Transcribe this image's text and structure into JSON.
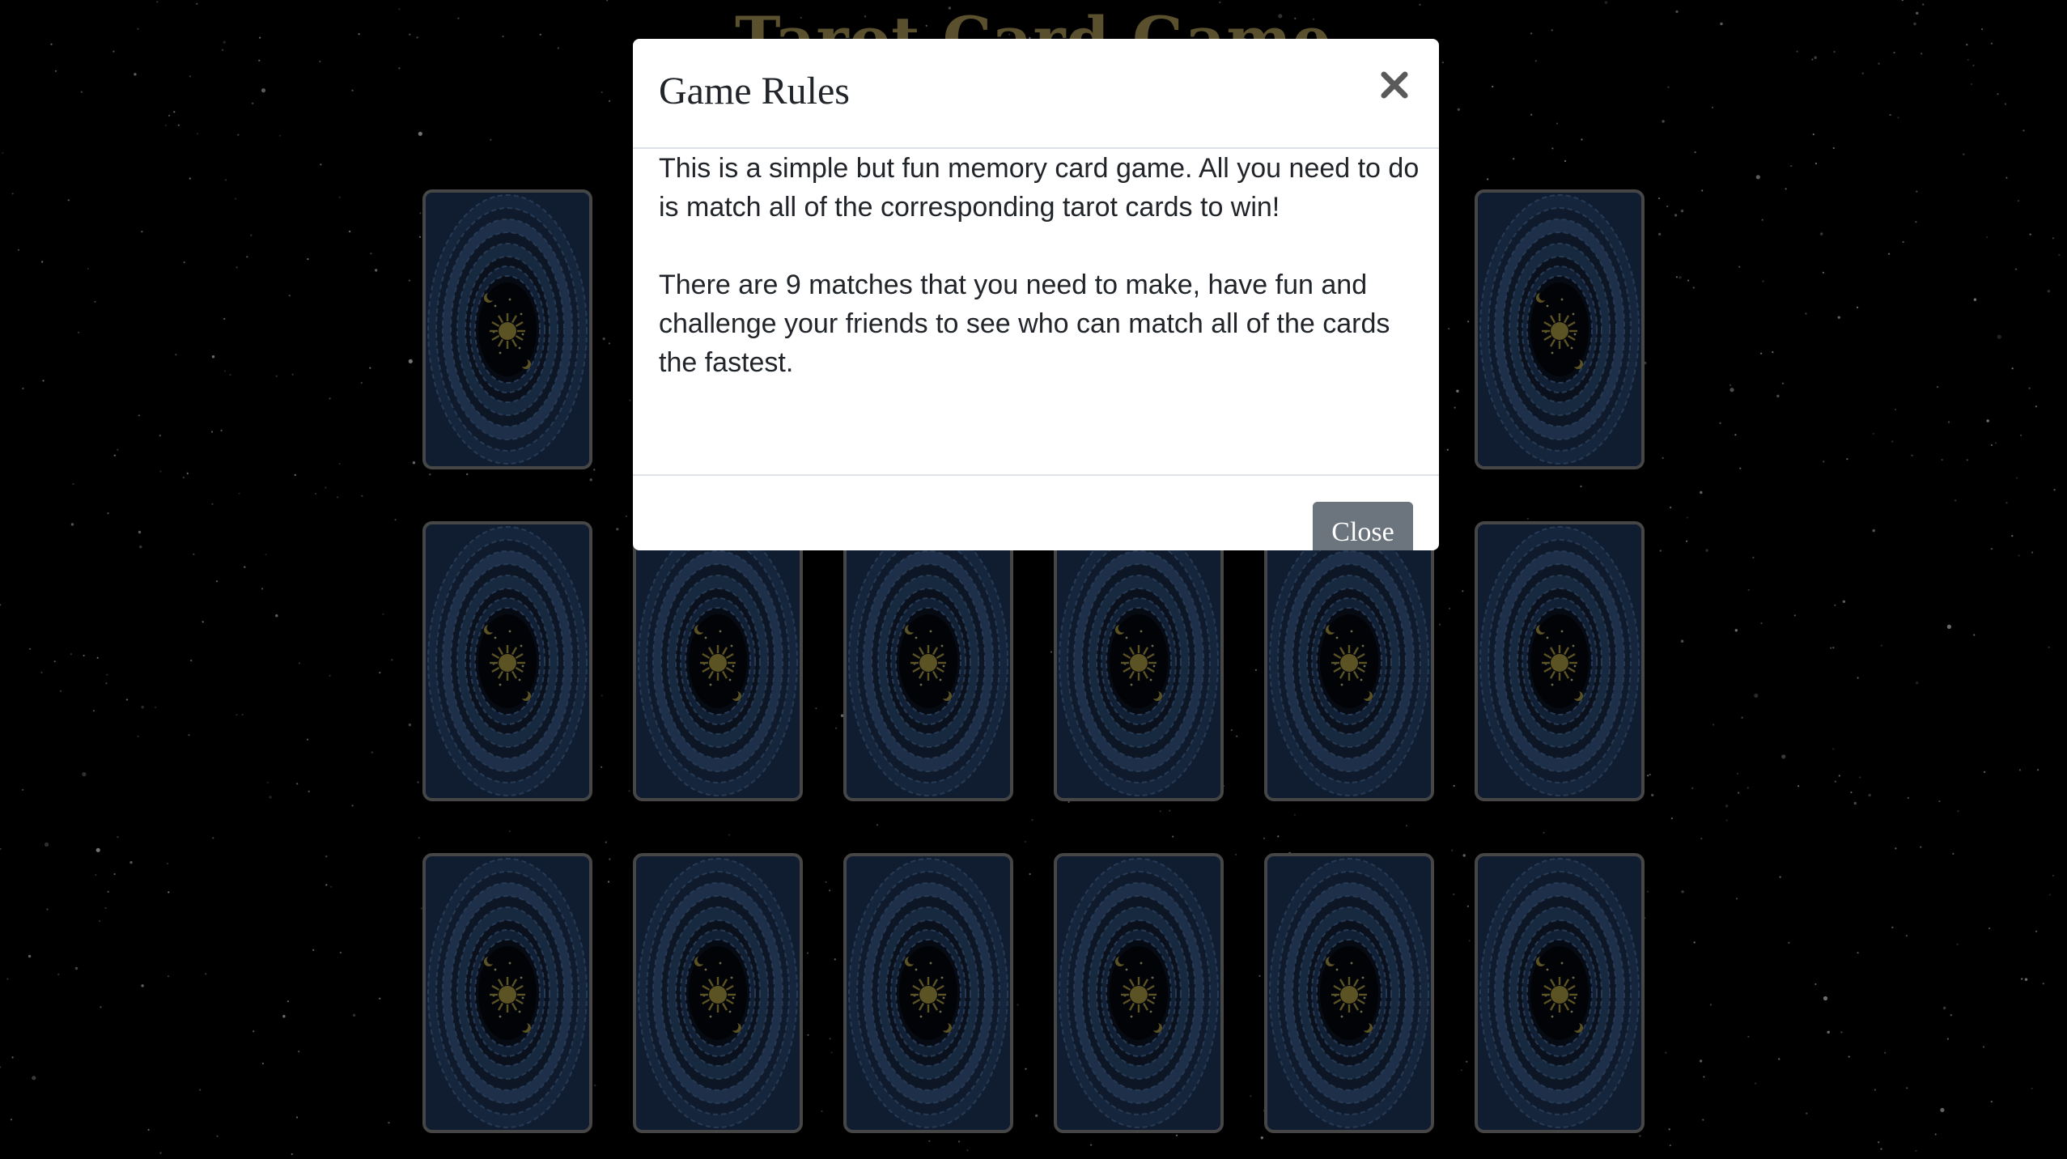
{
  "page": {
    "title": "Tarot Card Game"
  },
  "board": {
    "card_back": "tarot-card-back",
    "card_count": 18,
    "matches": 9
  },
  "modal": {
    "title": "Game Rules",
    "close_icon": "close-icon",
    "paragraphs": [
      "This is a simple but fun memory card game. All you need to do is match all of the corresponding tarot cards to win!",
      "There are 9 matches that you need to make, have fun and challenge your friends to see who can match all of the cards the fastest."
    ],
    "close_button_label": "Close"
  },
  "colors": {
    "background": "#000000",
    "title": "#b6a15a",
    "card_border": "#8c8c8c",
    "card_blue": "#213a63",
    "card_sun": "#b8a64a",
    "modal_bg": "#ffffff",
    "close_button": "#6c757d"
  }
}
